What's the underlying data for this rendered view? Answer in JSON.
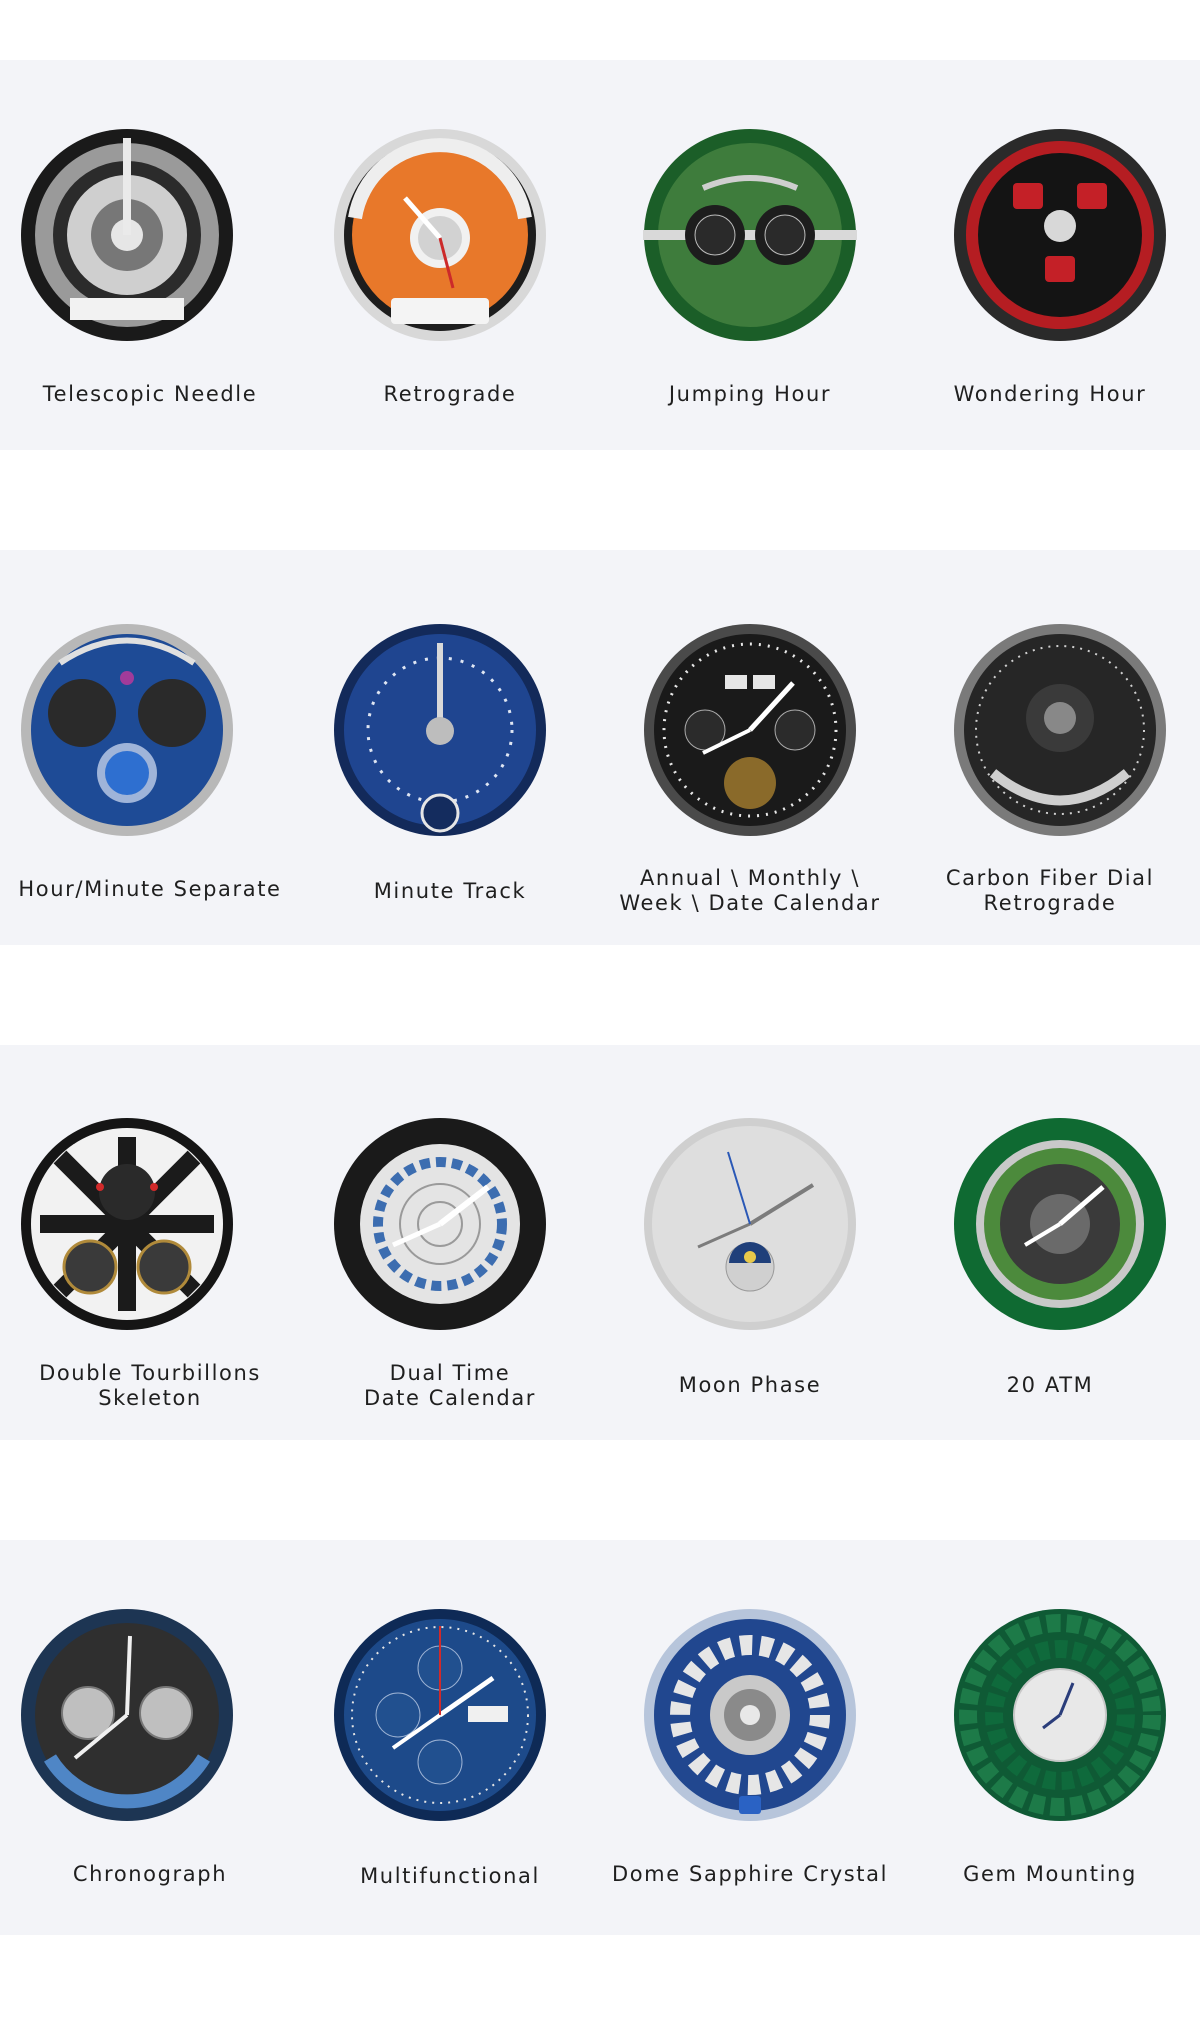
{
  "sections": [
    {
      "items": [
        {
          "label": "Telescopic Needle"
        },
        {
          "label": "Retrograde"
        },
        {
          "label": "Jumping Hour"
        },
        {
          "label": "Wondering Hour"
        }
      ]
    },
    {
      "items": [
        {
          "label": "Hour/Minute Separate"
        },
        {
          "label": "Minute Track"
        },
        {
          "label": "Annual \\ Monthly \\\nWeek \\ Date Calendar"
        },
        {
          "label": "Carbon Fiber Dial\nRetrograde"
        }
      ]
    },
    {
      "items": [
        {
          "label": "Double Tourbillons\nSkeleton"
        },
        {
          "label": "Dual Time\nDate Calendar"
        },
        {
          "label": "Moon Phase"
        },
        {
          "label": "20 ATM"
        }
      ]
    },
    {
      "items": [
        {
          "label": "Chronograph"
        },
        {
          "label": "Multifunctional"
        },
        {
          "label": "Dome Sapphire Crystal"
        },
        {
          "label": "Gem Mounting"
        }
      ]
    }
  ],
  "colors": {
    "band_background": "#f3f4f8",
    "page_background": "#ffffff",
    "label_text": "#1f1f1f"
  }
}
